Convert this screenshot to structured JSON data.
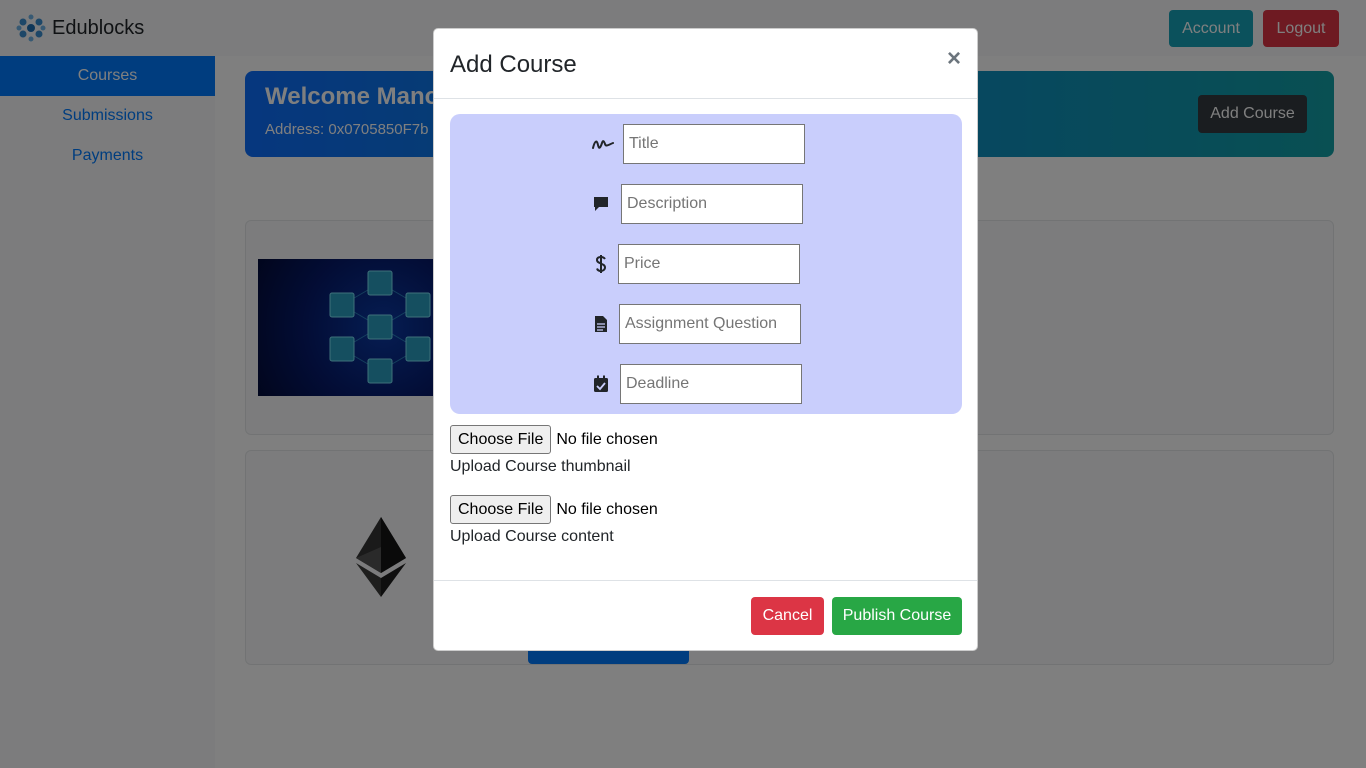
{
  "app": {
    "brand": "Edublocks"
  },
  "navbar": {
    "account_label": "Account",
    "logout_label": "Logout"
  },
  "sidebar": {
    "items": [
      {
        "label": "Courses",
        "active": true
      },
      {
        "label": "Submissions",
        "active": false
      },
      {
        "label": "Payments",
        "active": false
      }
    ]
  },
  "welcome": {
    "title": "Welcome Mano",
    "address": "Address: 0x0705850F7b",
    "add_course_label": "Add Course"
  },
  "modal": {
    "title": "Add Course",
    "close_glyph": "×",
    "fields": {
      "title_placeholder": "Title",
      "description_placeholder": "Description",
      "price_placeholder": "Price",
      "assignment_placeholder": "Assignment Question",
      "deadline_placeholder": "Deadline"
    },
    "thumbnail_upload": {
      "button": "Choose File",
      "status": "No file chosen",
      "label": "Upload Course thumbnail"
    },
    "content_upload": {
      "button": "Choose File",
      "status": "No file chosen",
      "label": "Upload Course content"
    },
    "cancel_label": "Cancel",
    "publish_label": "Publish Course"
  },
  "colors": {
    "primary": "#007bff",
    "danger": "#dc3545",
    "success": "#28a745",
    "info": "#17a2b8",
    "dark": "#343a40",
    "form_panel": "#c9cefc"
  },
  "icons": {
    "title": "signature-icon",
    "description": "comment-icon",
    "price": "dollar-icon",
    "assignment": "file-icon",
    "deadline": "calendar-check-icon"
  }
}
